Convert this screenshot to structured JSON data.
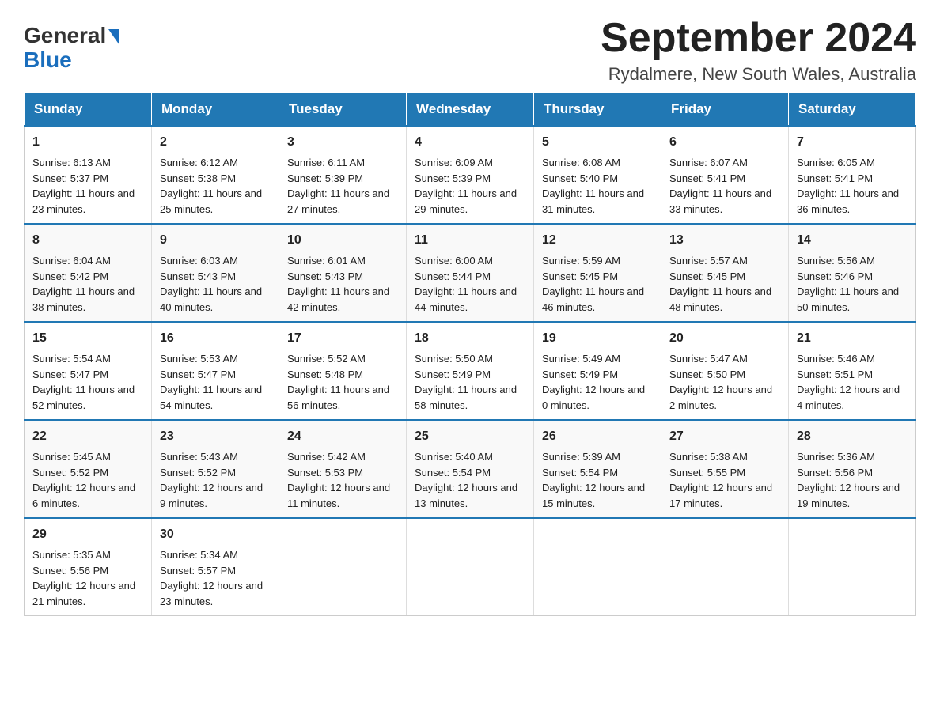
{
  "header": {
    "logo_line1": "General",
    "logo_line2": "Blue",
    "month_title": "September 2024",
    "location": "Rydalmere, New South Wales, Australia"
  },
  "days_of_week": [
    "Sunday",
    "Monday",
    "Tuesday",
    "Wednesday",
    "Thursday",
    "Friday",
    "Saturday"
  ],
  "weeks": [
    [
      {
        "num": "1",
        "sunrise": "6:13 AM",
        "sunset": "5:37 PM",
        "daylight": "11 hours and 23 minutes."
      },
      {
        "num": "2",
        "sunrise": "6:12 AM",
        "sunset": "5:38 PM",
        "daylight": "11 hours and 25 minutes."
      },
      {
        "num": "3",
        "sunrise": "6:11 AM",
        "sunset": "5:39 PM",
        "daylight": "11 hours and 27 minutes."
      },
      {
        "num": "4",
        "sunrise": "6:09 AM",
        "sunset": "5:39 PM",
        "daylight": "11 hours and 29 minutes."
      },
      {
        "num": "5",
        "sunrise": "6:08 AM",
        "sunset": "5:40 PM",
        "daylight": "11 hours and 31 minutes."
      },
      {
        "num": "6",
        "sunrise": "6:07 AM",
        "sunset": "5:41 PM",
        "daylight": "11 hours and 33 minutes."
      },
      {
        "num": "7",
        "sunrise": "6:05 AM",
        "sunset": "5:41 PM",
        "daylight": "11 hours and 36 minutes."
      }
    ],
    [
      {
        "num": "8",
        "sunrise": "6:04 AM",
        "sunset": "5:42 PM",
        "daylight": "11 hours and 38 minutes."
      },
      {
        "num": "9",
        "sunrise": "6:03 AM",
        "sunset": "5:43 PM",
        "daylight": "11 hours and 40 minutes."
      },
      {
        "num": "10",
        "sunrise": "6:01 AM",
        "sunset": "5:43 PM",
        "daylight": "11 hours and 42 minutes."
      },
      {
        "num": "11",
        "sunrise": "6:00 AM",
        "sunset": "5:44 PM",
        "daylight": "11 hours and 44 minutes."
      },
      {
        "num": "12",
        "sunrise": "5:59 AM",
        "sunset": "5:45 PM",
        "daylight": "11 hours and 46 minutes."
      },
      {
        "num": "13",
        "sunrise": "5:57 AM",
        "sunset": "5:45 PM",
        "daylight": "11 hours and 48 minutes."
      },
      {
        "num": "14",
        "sunrise": "5:56 AM",
        "sunset": "5:46 PM",
        "daylight": "11 hours and 50 minutes."
      }
    ],
    [
      {
        "num": "15",
        "sunrise": "5:54 AM",
        "sunset": "5:47 PM",
        "daylight": "11 hours and 52 minutes."
      },
      {
        "num": "16",
        "sunrise": "5:53 AM",
        "sunset": "5:47 PM",
        "daylight": "11 hours and 54 minutes."
      },
      {
        "num": "17",
        "sunrise": "5:52 AM",
        "sunset": "5:48 PM",
        "daylight": "11 hours and 56 minutes."
      },
      {
        "num": "18",
        "sunrise": "5:50 AM",
        "sunset": "5:49 PM",
        "daylight": "11 hours and 58 minutes."
      },
      {
        "num": "19",
        "sunrise": "5:49 AM",
        "sunset": "5:49 PM",
        "daylight": "12 hours and 0 minutes."
      },
      {
        "num": "20",
        "sunrise": "5:47 AM",
        "sunset": "5:50 PM",
        "daylight": "12 hours and 2 minutes."
      },
      {
        "num": "21",
        "sunrise": "5:46 AM",
        "sunset": "5:51 PM",
        "daylight": "12 hours and 4 minutes."
      }
    ],
    [
      {
        "num": "22",
        "sunrise": "5:45 AM",
        "sunset": "5:52 PM",
        "daylight": "12 hours and 6 minutes."
      },
      {
        "num": "23",
        "sunrise": "5:43 AM",
        "sunset": "5:52 PM",
        "daylight": "12 hours and 9 minutes."
      },
      {
        "num": "24",
        "sunrise": "5:42 AM",
        "sunset": "5:53 PM",
        "daylight": "12 hours and 11 minutes."
      },
      {
        "num": "25",
        "sunrise": "5:40 AM",
        "sunset": "5:54 PM",
        "daylight": "12 hours and 13 minutes."
      },
      {
        "num": "26",
        "sunrise": "5:39 AM",
        "sunset": "5:54 PM",
        "daylight": "12 hours and 15 minutes."
      },
      {
        "num": "27",
        "sunrise": "5:38 AM",
        "sunset": "5:55 PM",
        "daylight": "12 hours and 17 minutes."
      },
      {
        "num": "28",
        "sunrise": "5:36 AM",
        "sunset": "5:56 PM",
        "daylight": "12 hours and 19 minutes."
      }
    ],
    [
      {
        "num": "29",
        "sunrise": "5:35 AM",
        "sunset": "5:56 PM",
        "daylight": "12 hours and 21 minutes."
      },
      {
        "num": "30",
        "sunrise": "5:34 AM",
        "sunset": "5:57 PM",
        "daylight": "12 hours and 23 minutes."
      },
      null,
      null,
      null,
      null,
      null
    ]
  ],
  "labels": {
    "sunrise": "Sunrise:",
    "sunset": "Sunset:",
    "daylight": "Daylight:"
  }
}
